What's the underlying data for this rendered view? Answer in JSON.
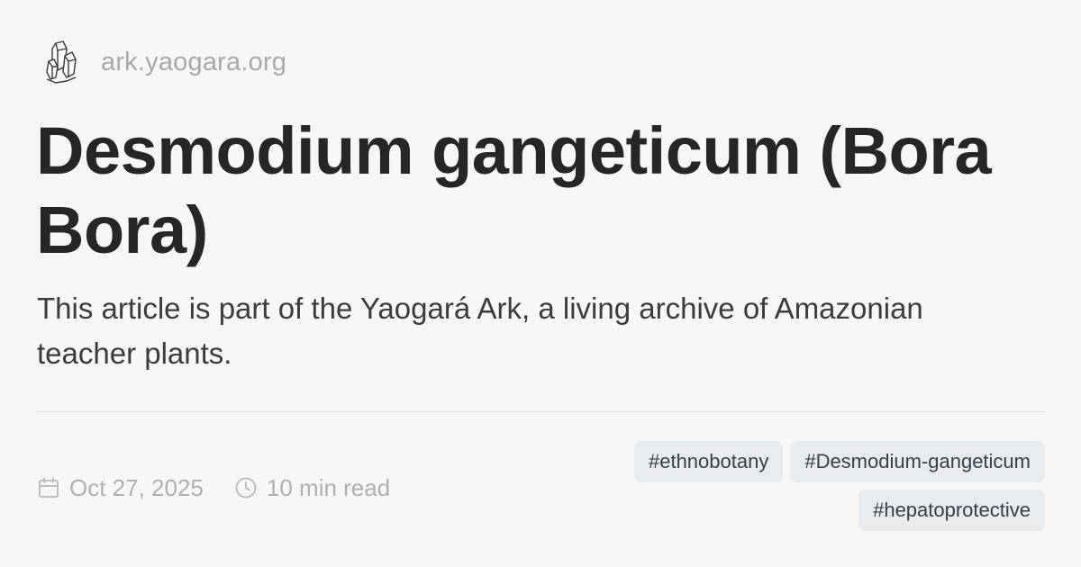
{
  "site": {
    "logo_icon": "crystal-icon",
    "domain": "ark.yaogara.org"
  },
  "article": {
    "title": "Desmodium gangeticum (Bora Bora)",
    "subtitle": "This article is part of the Yaogará Ark, a living archive of Amazonian teacher plants."
  },
  "meta": {
    "date_icon": "calendar-icon",
    "date": "Oct 27, 2025",
    "read_icon": "clock-icon",
    "read_time": "10 min read"
  },
  "tags": [
    "#ethnobotany",
    "#Desmodium-gangeticum",
    "#hepatoprotective"
  ],
  "colors": {
    "background": "#f7f7f8",
    "title": "#262626",
    "muted": "#b0b0b4",
    "tag_bg": "#e9ecef",
    "tag_text": "#34404a"
  }
}
